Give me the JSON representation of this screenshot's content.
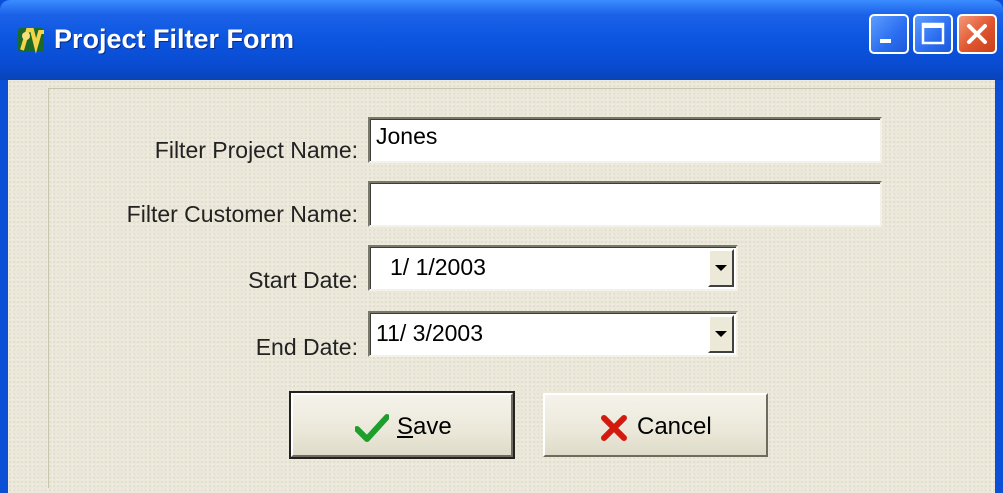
{
  "window": {
    "title": "Project Filter Form",
    "controls": [
      "minimize-icon",
      "maximize-icon",
      "close-icon"
    ]
  },
  "form": {
    "project_name": {
      "label": "Filter Project Name:",
      "value": "Jones"
    },
    "customer_name": {
      "label": "Filter Customer Name:",
      "value": ""
    },
    "start_date": {
      "label": "Start Date:",
      "value": "1/ 1/2003"
    },
    "end_date": {
      "label": "End Date:",
      "value": "11/ 3/2003"
    }
  },
  "buttons": {
    "save_label": "Save",
    "cancel_label": "Cancel"
  },
  "colors": {
    "title_bar": "#0a4fd6",
    "client_bg": "#ebe8d9",
    "check_green": "#1e9e2a",
    "cancel_red": "#d21a0f"
  }
}
